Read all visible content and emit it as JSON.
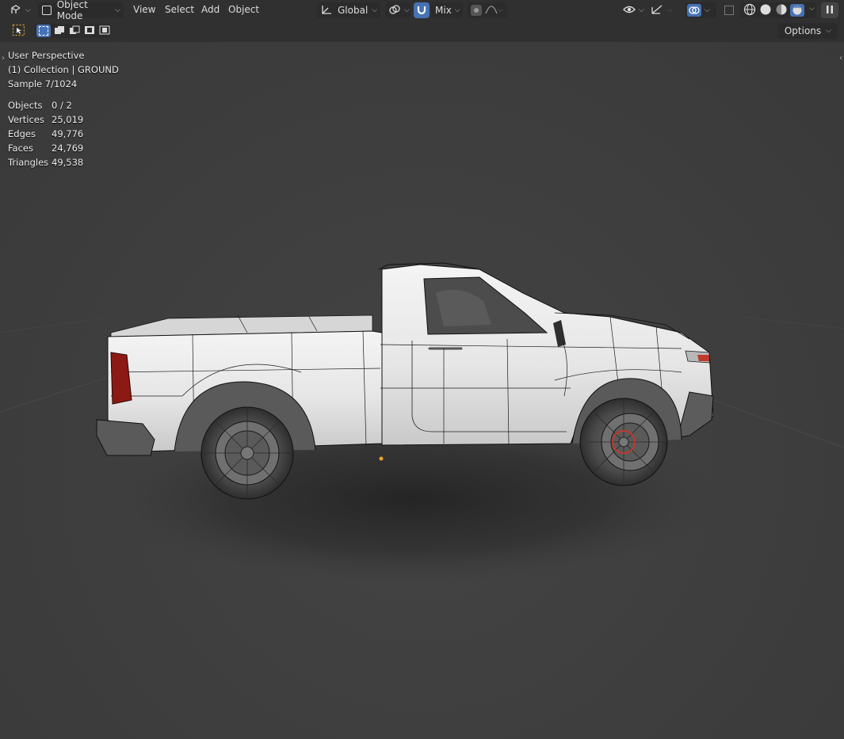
{
  "header": {
    "mode": "Object Mode",
    "menus": [
      "View",
      "Select",
      "Add",
      "Object"
    ],
    "orientation": "Global",
    "proportional": "Mix"
  },
  "toolbar": {
    "options_label": "Options"
  },
  "overlay": {
    "view_name": "User Perspective",
    "collection": "(1) Collection | GROUND",
    "sample": "Sample 7/1024"
  },
  "stats": [
    {
      "label": "Objects",
      "value": "0 / 2"
    },
    {
      "label": "Vertices",
      "value": "25,019"
    },
    {
      "label": "Edges",
      "value": "49,776"
    },
    {
      "label": "Faces",
      "value": "24,769"
    },
    {
      "label": "Triangles",
      "value": "49,538"
    }
  ],
  "colors": {
    "accent": "#4772b3",
    "header_bg": "#303030",
    "viewport_bg": "#3d3d3d",
    "taillight": "#8b1a14",
    "origin_dot": "#f0a030"
  }
}
